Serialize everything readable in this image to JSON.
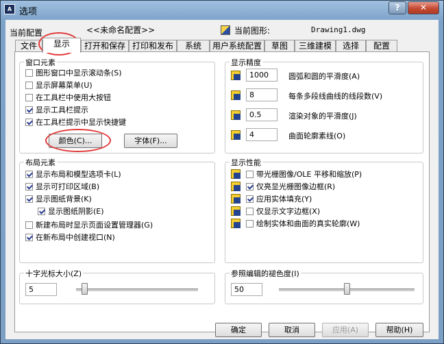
{
  "window": {
    "title": "选项",
    "app_icon": "AutoCAD",
    "help_glyph": "?",
    "close_glyph": "✕"
  },
  "profile": {
    "current_config_label": "当前配置",
    "current_config_value": "<<未命名配置>>",
    "current_drawing_label": "当前图形:",
    "current_drawing_value": "Drawing1.dwg"
  },
  "tabs": [
    {
      "label": "文件",
      "active": false
    },
    {
      "label": "显示",
      "active": true
    },
    {
      "label": "打开和保存",
      "active": false
    },
    {
      "label": "打印和发布",
      "active": false
    },
    {
      "label": "系统",
      "active": false
    },
    {
      "label": "用户系统配置",
      "active": false
    },
    {
      "label": "草图",
      "active": false
    },
    {
      "label": "三维建模",
      "active": false
    },
    {
      "label": "选择",
      "active": false
    },
    {
      "label": "配置",
      "active": false
    }
  ],
  "window_elements": {
    "title": "窗口元素",
    "items": [
      {
        "label": "图形窗口中显示滚动条(S)",
        "checked": false
      },
      {
        "label": "显示屏幕菜单(U)",
        "checked": false
      },
      {
        "label": "在工具栏中使用大按钮",
        "checked": false
      },
      {
        "label": "显示工具栏提示",
        "checked": true
      },
      {
        "label": "在工具栏提示中显示快捷键",
        "checked": true
      }
    ],
    "colors_button": "颜色(C)...",
    "fonts_button": "字体(F)..."
  },
  "layout_elements": {
    "title": "布局元素",
    "items": [
      {
        "label": "显示布局和模型选项卡(L)",
        "checked": true
      },
      {
        "label": "显示可打印区域(B)",
        "checked": true
      },
      {
        "label": "显示图纸背景(K)",
        "checked": true
      },
      {
        "label": "显示图纸阴影(E)",
        "checked": true
      },
      {
        "label": "新建布局时显示页面设置管理器(G)",
        "checked": false
      },
      {
        "label": "在新布局中创建视口(N)",
        "checked": true
      }
    ]
  },
  "display_resolution": {
    "title": "显示精度",
    "items": [
      {
        "value": "1000",
        "label": "圆弧和圆的平滑度(A)"
      },
      {
        "value": "8",
        "label": "每条多段线曲线的线段数(V)"
      },
      {
        "value": "0.5",
        "label": "渲染对象的平滑度(J)"
      },
      {
        "value": "4",
        "label": "曲面轮廓素线(O)"
      }
    ]
  },
  "display_performance": {
    "title": "显示性能",
    "items": [
      {
        "label": "带光栅图像/OLE 平移和缩放(P)",
        "checked": false
      },
      {
        "label": "仅亮显光栅图像边框(R)",
        "checked": true
      },
      {
        "label": "应用实体填充(Y)",
        "checked": true
      },
      {
        "label": "仅显示文字边框(X)",
        "checked": false
      },
      {
        "label": "绘制实体和曲面的真实轮廓(W)",
        "checked": false
      }
    ]
  },
  "crosshair": {
    "title": "十字光标大小(Z)",
    "value": "5",
    "level_percent": 5
  },
  "xref_fade": {
    "title": "参照编辑的褪色度(I)",
    "value": "50",
    "level_percent": 50
  },
  "footer": {
    "ok": "确定",
    "cancel": "取消",
    "apply": "应用(A)",
    "help": "帮助(H)"
  },
  "colors": {
    "highlight_oval": "#e23a3a",
    "title_bar": "#7da2c8",
    "close_button": "#c44a33"
  }
}
